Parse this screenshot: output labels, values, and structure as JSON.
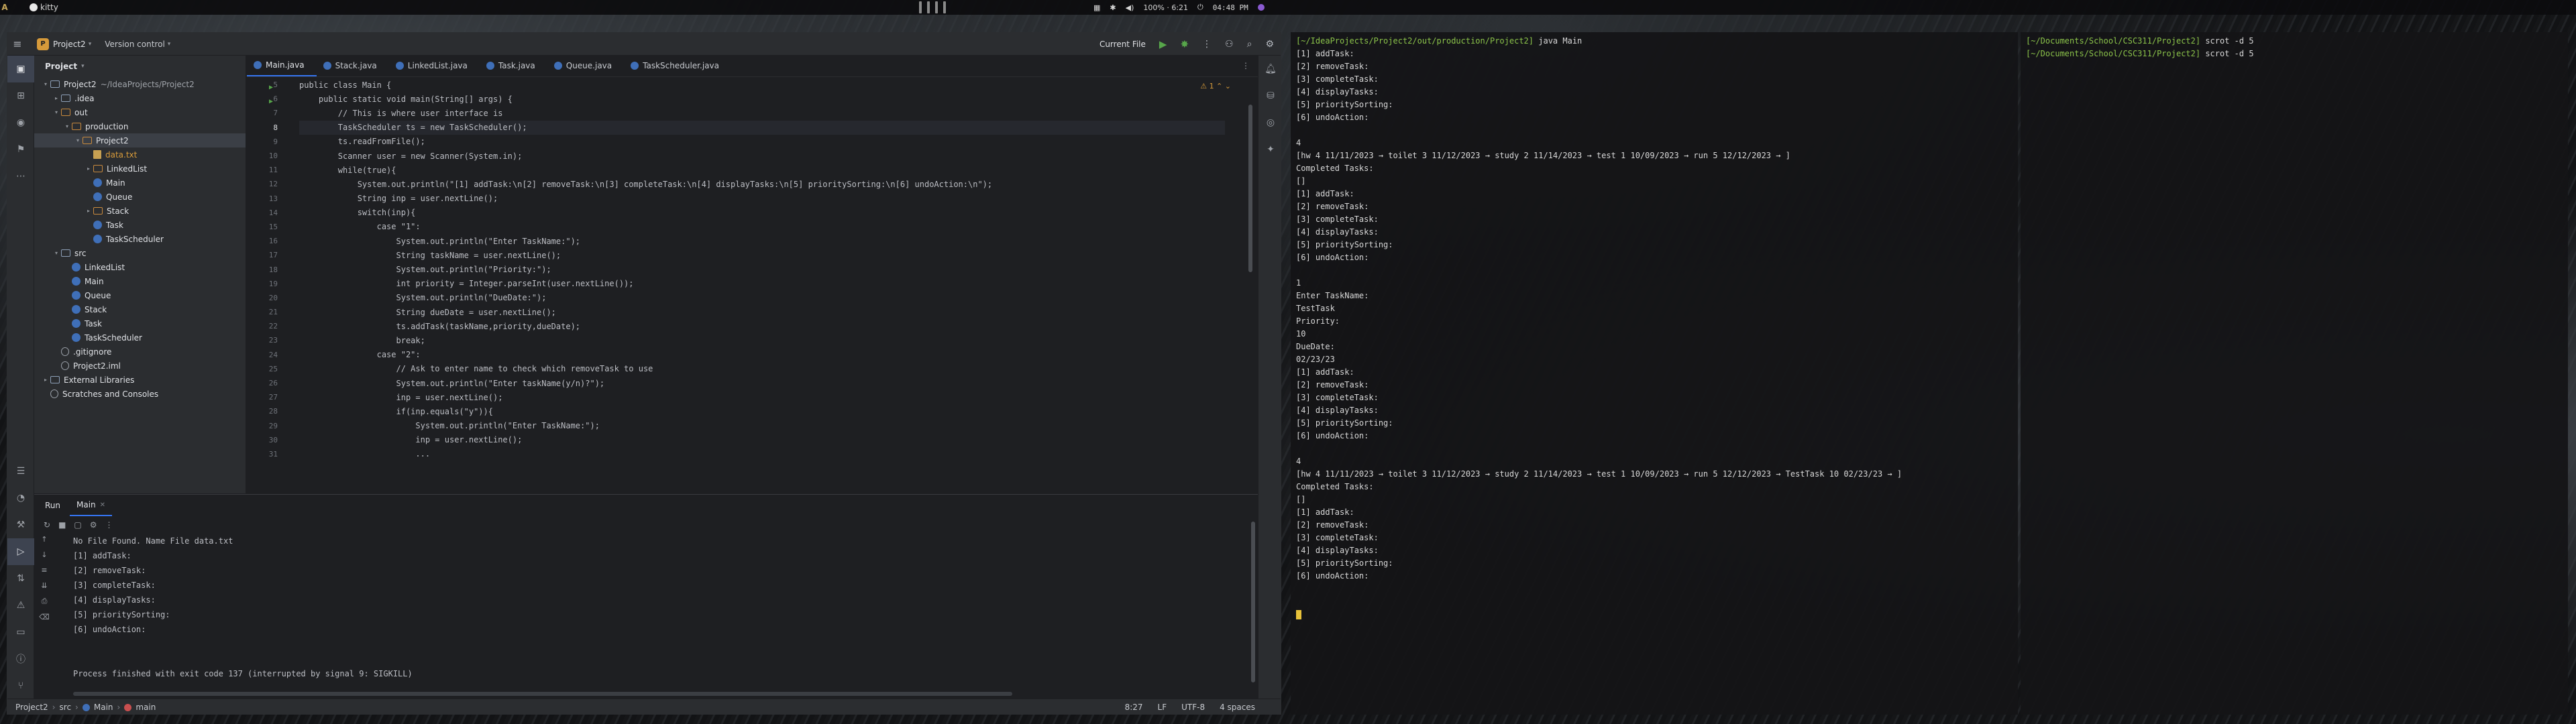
{
  "system_bar": {
    "workspace": "A",
    "window_title": "kitty",
    "battery": "100% · 6:21",
    "clock": "04:48 PM"
  },
  "ide": {
    "project_badge": "P",
    "project_name": "Project2",
    "version_control": "Version control",
    "run_config": "Current File",
    "project_panel_title": "Project",
    "tree": [
      {
        "label": "Project2",
        "extra": "~/IdeaProjects/Project2",
        "kind": "folder",
        "level": 1,
        "open": true
      },
      {
        "label": ".idea",
        "kind": "folder",
        "level": 2,
        "open": false
      },
      {
        "label": "out",
        "kind": "folder-orange",
        "level": 2,
        "open": true
      },
      {
        "label": "production",
        "kind": "folder-orange",
        "level": 3,
        "open": true
      },
      {
        "label": "Project2",
        "kind": "folder-orange",
        "level": 4,
        "open": true,
        "selected": true
      },
      {
        "label": "data.txt",
        "kind": "txt",
        "level": 5,
        "orange": true
      },
      {
        "label": "LinkedList",
        "kind": "folder-orange",
        "level": 5,
        "open": false
      },
      {
        "label": "Main",
        "kind": "class",
        "level": 5
      },
      {
        "label": "Queue",
        "kind": "class",
        "level": 5
      },
      {
        "label": "Stack",
        "kind": "folder-orange",
        "level": 5,
        "open": false
      },
      {
        "label": "Task",
        "kind": "class",
        "level": 5
      },
      {
        "label": "TaskScheduler",
        "kind": "class",
        "level": 5
      },
      {
        "label": "src",
        "kind": "folder",
        "level": 2,
        "open": true
      },
      {
        "label": "LinkedList",
        "kind": "class",
        "level": 3
      },
      {
        "label": "Main",
        "kind": "class",
        "level": 3
      },
      {
        "label": "Queue",
        "kind": "class",
        "level": 3
      },
      {
        "label": "Stack",
        "kind": "class",
        "level": 3
      },
      {
        "label": "Task",
        "kind": "class",
        "level": 3
      },
      {
        "label": "TaskScheduler",
        "kind": "class",
        "level": 3
      },
      {
        "label": ".gitignore",
        "kind": "gen",
        "level": 2
      },
      {
        "label": "Project2.iml",
        "kind": "gen",
        "level": 2
      },
      {
        "label": "External Libraries",
        "kind": "folder",
        "level": 1,
        "open": false
      },
      {
        "label": "Scratches and Consoles",
        "kind": "gen",
        "level": 1
      }
    ],
    "tabs": [
      "Main.java",
      "Stack.java",
      "LinkedList.java",
      "Task.java",
      "Queue.java",
      "TaskScheduler.java"
    ],
    "active_tab": 0,
    "warning_count": "1",
    "code_lines": [
      {
        "n": "5",
        "t": "public class Main {"
      },
      {
        "n": "6",
        "t": "    public static void main(String[] args) {"
      },
      {
        "n": "7",
        "t": "        // This is where user interface is"
      },
      {
        "n": "8",
        "t": "        TaskScheduler ts = new TaskScheduler();"
      },
      {
        "n": "9",
        "t": "        ts.readFromFile();"
      },
      {
        "n": "10",
        "t": "        Scanner user = new Scanner(System.in);"
      },
      {
        "n": "11",
        "t": "        while(true){"
      },
      {
        "n": "12",
        "t": "            System.out.println(\"[1] addTask:\\n[2] removeTask:\\n[3] completeTask:\\n[4] displayTasks:\\n[5] prioritySorting:\\n[6] undoAction:\\n\");"
      },
      {
        "n": "13",
        "t": "            String inp = user.nextLine();"
      },
      {
        "n": "14",
        "t": "            switch(inp){"
      },
      {
        "n": "15",
        "t": "                case \"1\":"
      },
      {
        "n": "16",
        "t": "                    System.out.println(\"Enter TaskName:\");"
      },
      {
        "n": "17",
        "t": "                    String taskName = user.nextLine();"
      },
      {
        "n": "18",
        "t": "                    System.out.println(\"Priority:\");"
      },
      {
        "n": "19",
        "t": "                    int priority = Integer.parseInt(user.nextLine());"
      },
      {
        "n": "20",
        "t": "                    System.out.println(\"DueDate:\");"
      },
      {
        "n": "21",
        "t": "                    String dueDate = user.nextLine();"
      },
      {
        "n": "22",
        "t": "                    ts.addTask(taskName,priority,dueDate);"
      },
      {
        "n": "23",
        "t": "                    break;"
      },
      {
        "n": "24",
        "t": "                case \"2\":"
      },
      {
        "n": "25",
        "t": "                    // Ask to enter name to check which removeTask to use"
      },
      {
        "n": "26",
        "t": "                    System.out.println(\"Enter taskName(y/n)?\");"
      },
      {
        "n": "27",
        "t": "                    inp = user.nextLine();"
      },
      {
        "n": "28",
        "t": "                    if(inp.equals(\"y\")){"
      },
      {
        "n": "29",
        "t": "                        System.out.println(\"Enter TaskName:\");"
      },
      {
        "n": "30",
        "t": "                        inp = user.nextLine();"
      },
      {
        "n": "31",
        "t": "                        ..."
      }
    ],
    "current_line": "8",
    "run_panel": {
      "title": "Run",
      "tab": "Main",
      "output": [
        "No File Found. Name File data.txt",
        "[1] addTask:",
        "[2] removeTask:",
        "[3] completeTask:",
        "[4] displayTasks:",
        "[5] prioritySorting:",
        "[6] undoAction:",
        "",
        "",
        "Process finished with exit code 137 (interrupted by signal 9: SIGKILL)"
      ]
    },
    "status_bar": {
      "crumbs": [
        "Project2",
        "src",
        "Main",
        "main"
      ],
      "position": "8:27",
      "line_sep": "LF",
      "encoding": "UTF-8",
      "indent": "4 spaces"
    }
  },
  "terminal1": {
    "lines": [
      {
        "p": "[~/IdeaProjects/Project2/out/production/Project2]",
        "c": " java Main"
      },
      {
        "c": "[1] addTask:"
      },
      {
        "c": "[2] removeTask:"
      },
      {
        "c": "[3] completeTask:"
      },
      {
        "c": "[4] displayTasks:"
      },
      {
        "c": "[5] prioritySorting:"
      },
      {
        "c": "[6] undoAction:"
      },
      {
        "c": ""
      },
      {
        "c": "4"
      },
      {
        "c": "[hw 4 11/11/2023 → toilet 3 11/12/2023 → study 2 11/14/2023 → test 1 10/09/2023 → run 5 12/12/2023 → ]"
      },
      {
        "c": "Completed Tasks:"
      },
      {
        "c": "[]"
      },
      {
        "c": "[1] addTask:"
      },
      {
        "c": "[2] removeTask:"
      },
      {
        "c": "[3] completeTask:"
      },
      {
        "c": "[4] displayTasks:"
      },
      {
        "c": "[5] prioritySorting:"
      },
      {
        "c": "[6] undoAction:"
      },
      {
        "c": ""
      },
      {
        "c": "1"
      },
      {
        "c": "Enter TaskName:"
      },
      {
        "c": "TestTask"
      },
      {
        "c": "Priority:"
      },
      {
        "c": "10"
      },
      {
        "c": "DueDate:"
      },
      {
        "c": "02/23/23"
      },
      {
        "c": "[1] addTask:"
      },
      {
        "c": "[2] removeTask:"
      },
      {
        "c": "[3] completeTask:"
      },
      {
        "c": "[4] displayTasks:"
      },
      {
        "c": "[5] prioritySorting:"
      },
      {
        "c": "[6] undoAction:"
      },
      {
        "c": ""
      },
      {
        "c": "4"
      },
      {
        "c": "[hw 4 11/11/2023 → toilet 3 11/12/2023 → study 2 11/14/2023 → test 1 10/09/2023 → run 5 12/12/2023 → TestTask 10 02/23/23 → ]"
      },
      {
        "c": "Completed Tasks:"
      },
      {
        "c": "[]"
      },
      {
        "c": "[1] addTask:"
      },
      {
        "c": "[2] removeTask:"
      },
      {
        "c": "[3] completeTask:"
      },
      {
        "c": "[4] displayTasks:"
      },
      {
        "c": "[5] prioritySorting:"
      },
      {
        "c": "[6] undoAction:"
      },
      {
        "c": ""
      },
      {
        "c": ""
      }
    ]
  },
  "terminal2": {
    "lines": [
      {
        "p": "[~/Documents/School/CSC311/Project2]",
        "c": " scrot -d 5"
      },
      {
        "p": "[~/Documents/School/CSC311/Project2]",
        "c": " scrot -d 5"
      }
    ]
  },
  "colors": {
    "ide_bg": "#1e1f22",
    "ide_panel": "#2b2d30",
    "accent": "#3574f0",
    "prompt_green": "#8bc34a",
    "cursor_yellow": "#e8c23a"
  }
}
